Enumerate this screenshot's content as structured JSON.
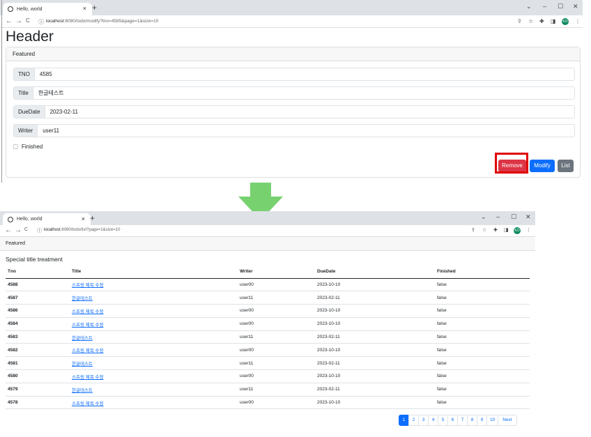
{
  "top": {
    "tab_title": "Hello, world",
    "tab_close": "×",
    "new_tab": "+",
    "window_controls": [
      "⌄",
      "–",
      "☐",
      "✕"
    ],
    "nav": [
      "←",
      "→",
      "C"
    ],
    "url_host": "localhost",
    "url_rest": ":8080/todo/modify?tno=4585&page=1&size=10",
    "avatar": "KO",
    "page_title": "Header",
    "card_header": "Featured",
    "fields": [
      {
        "label": "TNO",
        "value": "4585"
      },
      {
        "label": "Title",
        "value": "한글테스트"
      },
      {
        "label": "DueDate",
        "value": "2023-02-11"
      },
      {
        "label": "Writer",
        "value": "user11"
      }
    ],
    "finished_label": "Finished",
    "buttons": {
      "remove": "Remove",
      "modify": "Modify",
      "list": "List"
    },
    "highlight_color": "#e00000"
  },
  "arrow_color": "#77d16f",
  "bottom": {
    "tab_title": "Hello, world",
    "tab_close": "×",
    "new_tab": "+",
    "window_controls": [
      "⌄",
      "–",
      "☐",
      "✕"
    ],
    "nav": [
      "←",
      "→",
      "C"
    ],
    "url_host": "localhost",
    "url_rest": ":8080/todo/list?page=1&size=10",
    "avatar": "KO",
    "card_header": "Featured",
    "section_title": "Special title treatment",
    "columns": [
      "Tno",
      "Title",
      "Writer",
      "DueDate",
      "Finished"
    ],
    "rows": [
      {
        "tno": "4588",
        "title": "스프링 제목 수정",
        "writer": "user00",
        "due": "2023-10-10",
        "finished": "false"
      },
      {
        "tno": "4587",
        "title": "한글테스트",
        "writer": "user11",
        "due": "2023-02-11",
        "finished": "false"
      },
      {
        "tno": "4586",
        "title": "스프링 제목 수정",
        "writer": "user00",
        "due": "2023-10-10",
        "finished": "false"
      },
      {
        "tno": "4584",
        "title": "스프링 제목 수정",
        "writer": "user00",
        "due": "2023-10-10",
        "finished": "false"
      },
      {
        "tno": "4583",
        "title": "한글테스트",
        "writer": "user11",
        "due": "2023-02-11",
        "finished": "false"
      },
      {
        "tno": "4582",
        "title": "스프링 제목 수정",
        "writer": "user00",
        "due": "2023-10-10",
        "finished": "false"
      },
      {
        "tno": "4581",
        "title": "한글테스트",
        "writer": "user11",
        "due": "2023-02-11",
        "finished": "false"
      },
      {
        "tno": "4580",
        "title": "스프링 제목 수정",
        "writer": "user00",
        "due": "2023-10-10",
        "finished": "false"
      },
      {
        "tno": "4579",
        "title": "한글테스트",
        "writer": "user11",
        "due": "2023-02-11",
        "finished": "false"
      },
      {
        "tno": "4578",
        "title": "스프링 제목 수정",
        "writer": "user00",
        "due": "2023-10-10",
        "finished": "false"
      }
    ],
    "pages": [
      "1",
      "2",
      "3",
      "4",
      "5",
      "6",
      "7",
      "8",
      "9",
      "10"
    ],
    "next_label": "Next",
    "active_page": "1"
  }
}
